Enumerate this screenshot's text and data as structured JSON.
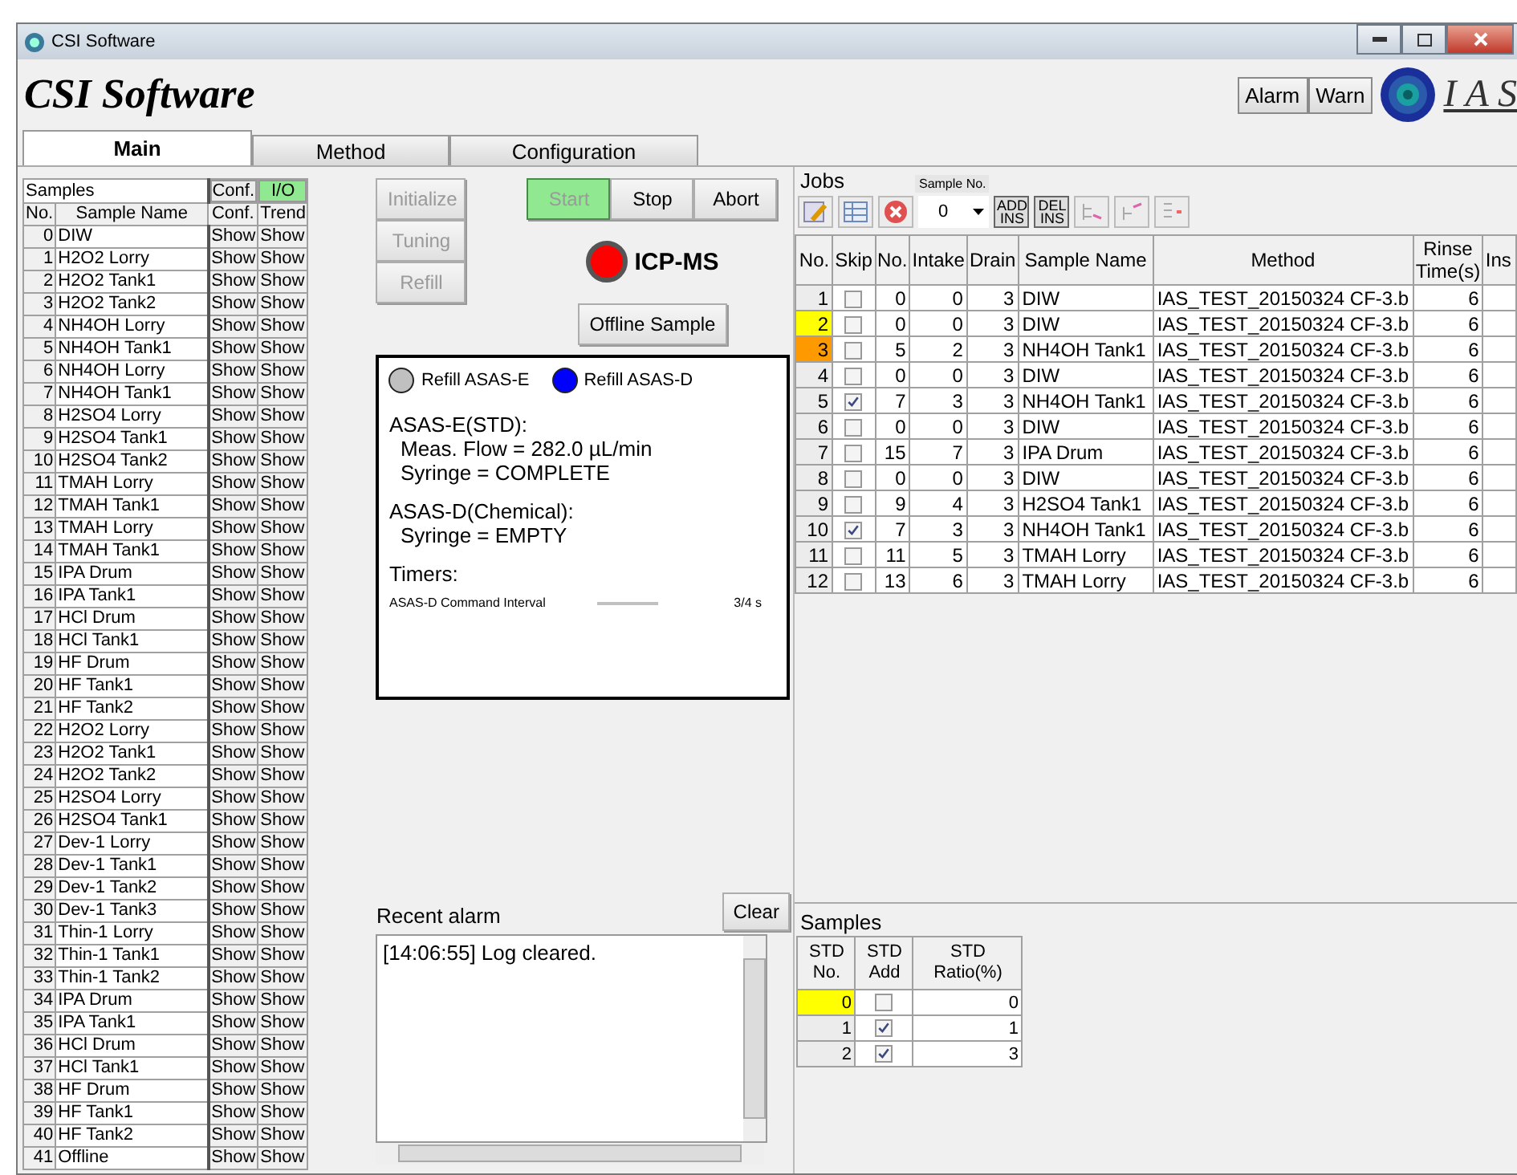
{
  "window": {
    "title": "CSI Software"
  },
  "header": {
    "app_title": "CSI Software",
    "buttons": [
      "Alarm",
      "Warn"
    ],
    "logo_text": "I A S"
  },
  "tabs": [
    {
      "label": "Main",
      "selected": true
    },
    {
      "label": "Method",
      "selected": false
    },
    {
      "label": "Configuration",
      "selected": false
    }
  ],
  "samples_table": {
    "title": "Samples",
    "toggles": [
      {
        "label": "Conf.",
        "selected": false
      },
      {
        "label": "I/O",
        "selected": true
      }
    ],
    "columns": [
      "No.",
      "Sample Name",
      "Conf.",
      "Trend"
    ],
    "rows": [
      {
        "no": "0",
        "name": "DIW",
        "conf": "Show",
        "trend": "Show"
      },
      {
        "no": "1",
        "name": "H2O2 Lorry",
        "conf": "Show",
        "trend": "Show"
      },
      {
        "no": "2",
        "name": "H2O2 Tank1",
        "conf": "Show",
        "trend": "Show"
      },
      {
        "no": "3",
        "name": "H2O2 Tank2",
        "conf": "Show",
        "trend": "Show"
      },
      {
        "no": "4",
        "name": "NH4OH Lorry",
        "conf": "Show",
        "trend": "Show"
      },
      {
        "no": "5",
        "name": "NH4OH Tank1",
        "conf": "Show",
        "trend": "Show"
      },
      {
        "no": "6",
        "name": "NH4OH Lorry",
        "conf": "Show",
        "trend": "Show"
      },
      {
        "no": "7",
        "name": "NH4OH Tank1",
        "conf": "Show",
        "trend": "Show"
      },
      {
        "no": "8",
        "name": "H2SO4 Lorry",
        "conf": "Show",
        "trend": "Show"
      },
      {
        "no": "9",
        "name": "H2SO4 Tank1",
        "conf": "Show",
        "trend": "Show"
      },
      {
        "no": "10",
        "name": "H2SO4 Tank2",
        "conf": "Show",
        "trend": "Show"
      },
      {
        "no": "11",
        "name": "TMAH Lorry",
        "conf": "Show",
        "trend": "Show"
      },
      {
        "no": "12",
        "name": "TMAH Tank1",
        "conf": "Show",
        "trend": "Show"
      },
      {
        "no": "13",
        "name": "TMAH Lorry",
        "conf": "Show",
        "trend": "Show"
      },
      {
        "no": "14",
        "name": "TMAH Tank1",
        "conf": "Show",
        "trend": "Show"
      },
      {
        "no": "15",
        "name": "IPA Drum",
        "conf": "Show",
        "trend": "Show"
      },
      {
        "no": "16",
        "name": "IPA Tank1",
        "conf": "Show",
        "trend": "Show"
      },
      {
        "no": "17",
        "name": "HCl Drum",
        "conf": "Show",
        "trend": "Show"
      },
      {
        "no": "18",
        "name": "HCl Tank1",
        "conf": "Show",
        "trend": "Show"
      },
      {
        "no": "19",
        "name": "HF Drum",
        "conf": "Show",
        "trend": "Show"
      },
      {
        "no": "20",
        "name": "HF Tank1",
        "conf": "Show",
        "trend": "Show"
      },
      {
        "no": "21",
        "name": "HF Tank2",
        "conf": "Show",
        "trend": "Show"
      },
      {
        "no": "22",
        "name": "H2O2 Lorry",
        "conf": "Show",
        "trend": "Show"
      },
      {
        "no": "23",
        "name": "H2O2 Tank1",
        "conf": "Show",
        "trend": "Show"
      },
      {
        "no": "24",
        "name": "H2O2 Tank2",
        "conf": "Show",
        "trend": "Show"
      },
      {
        "no": "25",
        "name": "H2SO4 Lorry",
        "conf": "Show",
        "trend": "Show"
      },
      {
        "no": "26",
        "name": "H2SO4 Tank1",
        "conf": "Show",
        "trend": "Show"
      },
      {
        "no": "27",
        "name": "Dev-1 Lorry",
        "conf": "Show",
        "trend": "Show"
      },
      {
        "no": "28",
        "name": "Dev-1 Tank1",
        "conf": "Show",
        "trend": "Show"
      },
      {
        "no": "29",
        "name": "Dev-1 Tank2",
        "conf": "Show",
        "trend": "Show"
      },
      {
        "no": "30",
        "name": "Dev-1 Tank3",
        "conf": "Show",
        "trend": "Show"
      },
      {
        "no": "31",
        "name": "Thin-1 Lorry",
        "conf": "Show",
        "trend": "Show"
      },
      {
        "no": "32",
        "name": "Thin-1 Tank1",
        "conf": "Show",
        "trend": "Show"
      },
      {
        "no": "33",
        "name": "Thin-1 Tank2",
        "conf": "Show",
        "trend": "Show"
      },
      {
        "no": "34",
        "name": "IPA Drum",
        "conf": "Show",
        "trend": "Show"
      },
      {
        "no": "35",
        "name": "IPA Tank1",
        "conf": "Show",
        "trend": "Show"
      },
      {
        "no": "36",
        "name": "HCl Drum",
        "conf": "Show",
        "trend": "Show"
      },
      {
        "no": "37",
        "name": "HCl Tank1",
        "conf": "Show",
        "trend": "Show"
      },
      {
        "no": "38",
        "name": "HF Drum",
        "conf": "Show",
        "trend": "Show"
      },
      {
        "no": "39",
        "name": "HF Tank1",
        "conf": "Show",
        "trend": "Show"
      },
      {
        "no": "40",
        "name": "HF Tank2",
        "conf": "Show",
        "trend": "Show"
      },
      {
        "no": "41",
        "name": "Offline",
        "conf": "Show",
        "trend": "Show"
      }
    ]
  },
  "side_buttons": [
    {
      "label": "Initialize",
      "disabled": true
    },
    {
      "label": "Tuning",
      "disabled": true
    },
    {
      "label": "Refill",
      "disabled": true
    }
  ],
  "run_buttons": [
    {
      "label": "Start",
      "active": true,
      "disabled": true
    },
    {
      "label": "Stop",
      "active": false,
      "disabled": false
    },
    {
      "label": "Abort",
      "active": false,
      "disabled": false
    }
  ],
  "instrument": {
    "label": "ICP-MS",
    "color": "#ff0000"
  },
  "offline_button": "Offline Sample",
  "status_panel": {
    "lamps": [
      {
        "label": "Refill ASAS-E",
        "color": "#c0c0c0"
      },
      {
        "label": "Refill ASAS-D",
        "color": "#0000ff"
      }
    ],
    "groups": [
      {
        "title": "ASAS-E(STD):",
        "lines": [
          "Meas. Flow = 282.0 µL/min",
          "Syringe = COMPLETE"
        ]
      },
      {
        "title": "ASAS-D(Chemical):",
        "lines": [
          "Syringe = EMPTY"
        ]
      }
    ],
    "timers_label": "Timers:",
    "timers": [
      {
        "name": "ASAS-D Command Interval",
        "value": "3/4 s"
      }
    ]
  },
  "alarm": {
    "label": "Recent alarm",
    "clear_button": "Clear",
    "log": [
      "[14:06:55] Log cleared."
    ]
  },
  "jobs": {
    "title": "Jobs",
    "sample_no_label": "Sample No.",
    "sample_no_value": "0",
    "insert_buttons": [
      "ADD INS",
      "DEL INS"
    ],
    "columns": [
      "No.",
      "Skip",
      "No.",
      "Intake",
      "Drain",
      "Sample Name",
      "Method",
      "Rinse Time(s)",
      "Ins"
    ],
    "rows": [
      {
        "no": "1",
        "skip": false,
        "sample_no": "0",
        "intake": "0",
        "drain": "3",
        "sample_name": "DIW",
        "method": "IAS_TEST_20150324 CF-3.b",
        "rinse": "6"
      },
      {
        "no": "2",
        "color": "#ffff00",
        "skip": false,
        "sample_no": "0",
        "intake": "0",
        "drain": "3",
        "sample_name": "DIW",
        "method": "IAS_TEST_20150324 CF-3.b",
        "rinse": "6"
      },
      {
        "no": "3",
        "color": "#ff9900",
        "skip": false,
        "sample_no": "5",
        "intake": "2",
        "drain": "3",
        "sample_name": "NH4OH Tank1",
        "method": "IAS_TEST_20150324 CF-3.b",
        "rinse": "6"
      },
      {
        "no": "4",
        "skip": false,
        "sample_no": "0",
        "intake": "0",
        "drain": "3",
        "sample_name": "DIW",
        "method": "IAS_TEST_20150324 CF-3.b",
        "rinse": "6"
      },
      {
        "no": "5",
        "skip": true,
        "sample_no": "7",
        "intake": "3",
        "drain": "3",
        "sample_name": "NH4OH Tank1",
        "method": "IAS_TEST_20150324 CF-3.b",
        "rinse": "6"
      },
      {
        "no": "6",
        "skip": false,
        "sample_no": "0",
        "intake": "0",
        "drain": "3",
        "sample_name": "DIW",
        "method": "IAS_TEST_20150324 CF-3.b",
        "rinse": "6"
      },
      {
        "no": "7",
        "skip": false,
        "sample_no": "15",
        "intake": "7",
        "drain": "3",
        "sample_name": "IPA Drum",
        "method": "IAS_TEST_20150324 CF-3.b",
        "rinse": "6"
      },
      {
        "no": "8",
        "skip": false,
        "sample_no": "0",
        "intake": "0",
        "drain": "3",
        "sample_name": "DIW",
        "method": "IAS_TEST_20150324 CF-3.b",
        "rinse": "6"
      },
      {
        "no": "9",
        "skip": false,
        "sample_no": "9",
        "intake": "4",
        "drain": "3",
        "sample_name": "H2SO4 Tank1",
        "method": "IAS_TEST_20150324 CF-3.b",
        "rinse": "6"
      },
      {
        "no": "10",
        "skip": true,
        "sample_no": "7",
        "intake": "3",
        "drain": "3",
        "sample_name": "NH4OH Tank1",
        "method": "IAS_TEST_20150324 CF-3.b",
        "rinse": "6"
      },
      {
        "no": "11",
        "skip": false,
        "sample_no": "11",
        "intake": "5",
        "drain": "3",
        "sample_name": "TMAH Lorry",
        "method": "IAS_TEST_20150324 CF-3.b",
        "rinse": "6"
      },
      {
        "no": "12",
        "skip": false,
        "sample_no": "13",
        "intake": "6",
        "drain": "3",
        "sample_name": "TMAH Lorry",
        "method": "IAS_TEST_20150324 CF-3.b",
        "rinse": "6"
      }
    ]
  },
  "std_samples": {
    "title": "Samples",
    "columns": [
      "STD No.",
      "STD Add",
      "STD Ratio(%)"
    ],
    "rows": [
      {
        "no": "0",
        "color": "#ffff00",
        "add": false,
        "ratio": "0"
      },
      {
        "no": "1",
        "add": true,
        "ratio": "1"
      },
      {
        "no": "2",
        "add": true,
        "ratio": "3"
      }
    ]
  }
}
